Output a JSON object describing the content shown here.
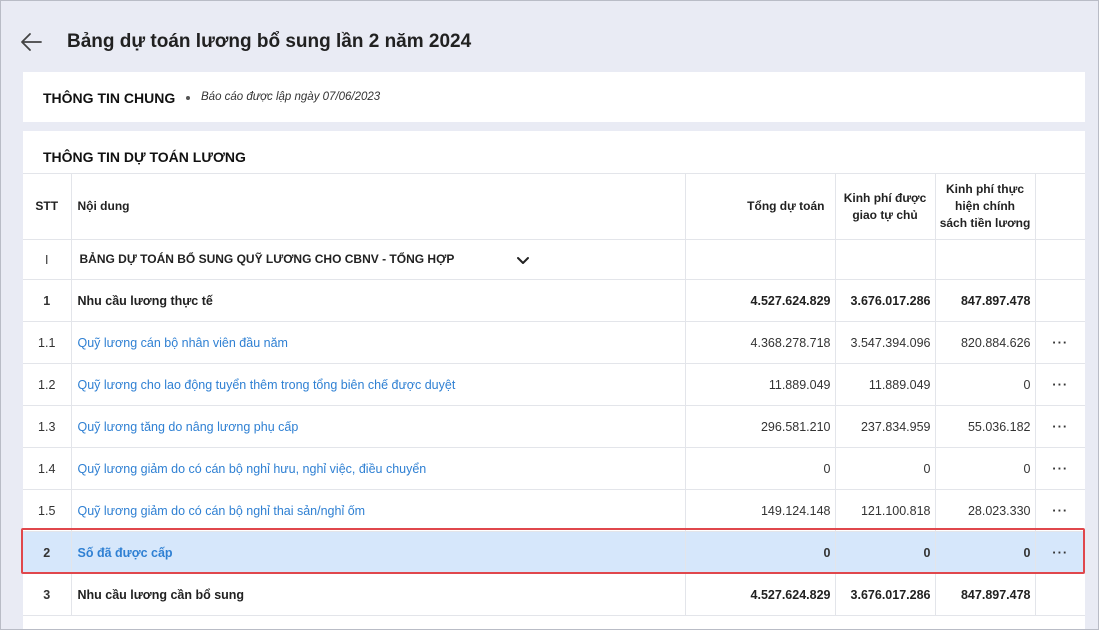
{
  "header": {
    "title": "Bảng dự toán lương bổ sung lần 2 năm 2024",
    "back_icon": "arrow-left-icon"
  },
  "general": {
    "title": "THÔNG TIN CHUNG",
    "subtitle": "Báo cáo được lập ngày 07/06/2023"
  },
  "budget": {
    "title": "THÔNG TIN DỰ TOÁN LƯƠNG",
    "columns": {
      "stt": "STT",
      "content": "Nội dung",
      "total": "Tổng dự toán",
      "kp_auto_1": "Kinh phí được",
      "kp_auto_2": "giao tự chủ",
      "kp_policy_1": "Kinh phí thực",
      "kp_policy_2": "hiện chính",
      "kp_policy_3": "sách tiền lương"
    },
    "group": {
      "stt": "I",
      "label": "BẢNG DỰ TOÁN BỔ SUNG QUỸ LƯƠNG CHO CBNV - TỔNG HỢP"
    },
    "rows": [
      {
        "stt": "1",
        "content": "Nhu cầu lương thực tế",
        "total": "4.527.624.829",
        "kp_auto": "3.676.017.286",
        "kp_policy": "847.897.478"
      },
      {
        "stt": "1.1",
        "content": "Quỹ lương cán bộ nhân viên đầu năm",
        "total": "4.368.278.718",
        "kp_auto": "3.547.394.096",
        "kp_policy": "820.884.626"
      },
      {
        "stt": "1.2",
        "content": "Quỹ lương cho lao động tuyển thêm trong tổng biên chế được duyệt",
        "total": "11.889.049",
        "kp_auto": "11.889.049",
        "kp_policy": "0"
      },
      {
        "stt": "1.3",
        "content": "Quỹ lương tăng do nâng lương phụ cấp",
        "total": "296.581.210",
        "kp_auto": "237.834.959",
        "kp_policy": "55.036.182"
      },
      {
        "stt": "1.4",
        "content": "Quỹ lương giảm do có cán bộ nghỉ hưu, nghỉ việc, điều chuyển",
        "total": "0",
        "kp_auto": "0",
        "kp_policy": "0"
      },
      {
        "stt": "1.5",
        "content": "Quỹ lương giảm do có cán bộ nghỉ thai sản/nghỉ ốm",
        "total": "149.124.148",
        "kp_auto": "121.100.818",
        "kp_policy": "28.023.330"
      },
      {
        "stt": "2",
        "content": "Số đã được cấp",
        "total": "0",
        "kp_auto": "0",
        "kp_policy": "0"
      },
      {
        "stt": "3",
        "content": "Nhu cầu lương cần bổ sung",
        "total": "4.527.624.829",
        "kp_auto": "3.676.017.286",
        "kp_policy": "847.897.478"
      }
    ],
    "more_label": "···"
  },
  "colors": {
    "link": "#2f80d3",
    "selected_bg": "#d6e7fb",
    "highlight_border": "#e0474c",
    "page_bg": "#e9ebf4"
  }
}
